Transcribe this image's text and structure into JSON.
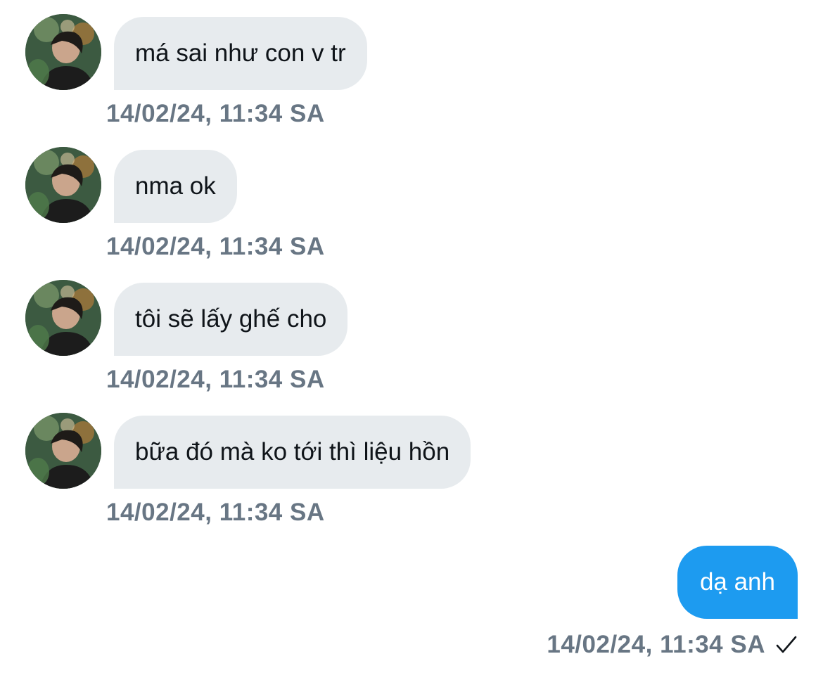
{
  "messages": [
    {
      "direction": "incoming",
      "text": "má sai như con v tr",
      "timestamp": "14/02/24, 11:34 SA"
    },
    {
      "direction": "incoming",
      "text": "nma ok",
      "timestamp": "14/02/24, 11:34 SA"
    },
    {
      "direction": "incoming",
      "text": "tôi sẽ lấy ghế cho",
      "timestamp": "14/02/24, 11:34 SA"
    },
    {
      "direction": "incoming",
      "text": "bữa đó mà ko tới thì liệu hồn",
      "timestamp": "14/02/24, 11:34 SA"
    },
    {
      "direction": "outgoing",
      "text": "dạ anh",
      "timestamp": "14/02/24, 11:34 SA",
      "status_icon": "check-icon"
    }
  ],
  "colors": {
    "incoming_bubble": "#e7ebee",
    "outgoing_bubble": "#1d9bf0",
    "timestamp_text": "#687684",
    "message_text": "#0f1419"
  }
}
